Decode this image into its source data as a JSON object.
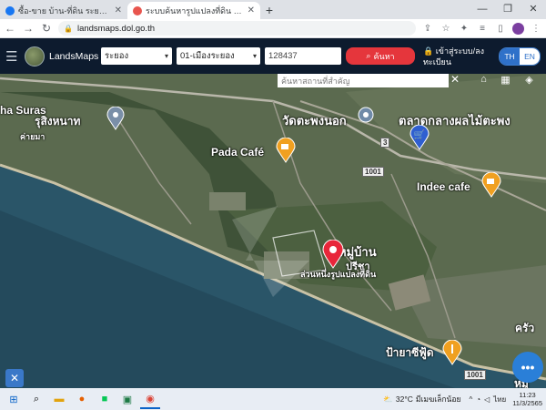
{
  "browser": {
    "tabs": [
      {
        "label": "ซื้อ-ขาย บ้าน-ที่ดิน ระยอง | Facebook",
        "active": false,
        "icon": "facebook-icon"
      },
      {
        "label": "ระบบค้นหารูปแปลงที่ดิน (LandsMaps)",
        "active": true,
        "icon": "map-pin-icon"
      }
    ],
    "url": "landsmaps.dol.go.th",
    "new_tab_label": "+"
  },
  "app": {
    "title": "LandsMaps",
    "province": "ระยอง",
    "district": "01-เมืองระยอง",
    "parcel_number": "128437",
    "search_label": "ค้นหา",
    "login_label": "เข้าสู่ระบบ/ลงทะเบียน",
    "lang": {
      "th": "TH",
      "en": "EN",
      "active": "TH"
    }
  },
  "map": {
    "search_placeholder": "ค้นหาสถานที่สำคัญ",
    "labels": [
      {
        "text": "ha Suras",
        "size": 12
      },
      {
        "text": "รุสิงหนาท",
        "size": 12
      },
      {
        "text": "ค่ายมา",
        "size": 9
      },
      {
        "text": "วัดตะพงนอก",
        "size": 13
      },
      {
        "text": "ตลาดกลางผลไม้ตะพง",
        "size": 13
      },
      {
        "text": "Pada Café",
        "size": 12
      },
      {
        "text": "Indee cafe",
        "size": 12
      },
      {
        "text": "หมู่บ้าน",
        "size": 13
      },
      {
        "text": "ปรีชา",
        "size": 11
      },
      {
        "text": "ล่วนหนึ่งรูปแปลงที่ดิน",
        "size": 9
      },
      {
        "text": "ป้ายาซีฟู้ด",
        "size": 12
      },
      {
        "text": "ครัว",
        "size": 12
      },
      {
        "text": "หมู่",
        "size": 12
      }
    ],
    "road_signs": [
      "1001",
      "1001",
      "3"
    ]
  },
  "taskbar": {
    "apps": [
      "windows-icon",
      "search-icon",
      "file-explorer-icon",
      "firefox-icon",
      "line-icon",
      "excel-icon",
      "chrome-icon"
    ],
    "temperature": "32°C",
    "weather_text": "มีเมฆเล็กน้อย",
    "language": "ไทย",
    "time": "11:23",
    "date": "11/3/2565"
  },
  "colors": {
    "header_bg": "#0d1b2e",
    "search_button": "#e5363c",
    "lang_active": "#2f71c9",
    "sea": "#2a5568",
    "land": "#5b6a4f",
    "chat_button": "#2a7fd8"
  }
}
